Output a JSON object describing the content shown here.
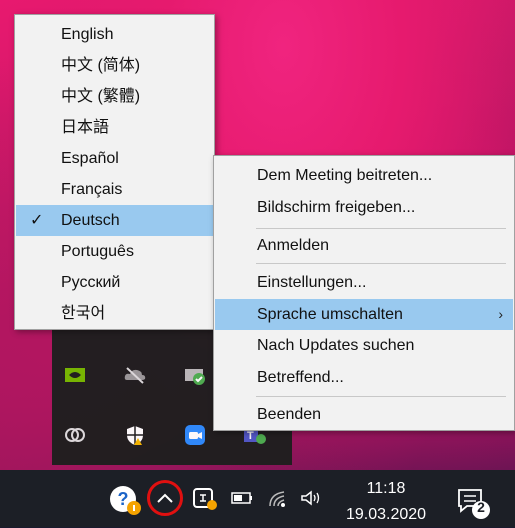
{
  "language_menu": {
    "items": [
      {
        "label": "English",
        "selected": false
      },
      {
        "label": "中文 (简体)",
        "selected": false
      },
      {
        "label": "中文 (繁體)",
        "selected": false
      },
      {
        "label": "日本語",
        "selected": false
      },
      {
        "label": "Español",
        "selected": false
      },
      {
        "label": "Français",
        "selected": false
      },
      {
        "label": "Deutsch",
        "selected": true
      },
      {
        "label": "Português",
        "selected": false
      },
      {
        "label": "Русский",
        "selected": false
      },
      {
        "label": "한국어",
        "selected": false
      }
    ],
    "check_mark": "✓"
  },
  "context_menu": {
    "items": [
      {
        "label": "Dem Meeting beitreten..."
      },
      {
        "label": "Bildschirm freigeben..."
      },
      {
        "label": "Anmelden"
      },
      {
        "label": "Einstellungen..."
      },
      {
        "label": "Sprache umschalten",
        "highlighted": true,
        "submenu": true
      },
      {
        "label": "Nach Updates suchen"
      },
      {
        "label": "Betreffend..."
      },
      {
        "label": "Beenden"
      }
    ],
    "submenu_arrow": "›"
  },
  "taskbar": {
    "clock_time": "11:18",
    "clock_date": "19.03.2020",
    "notification_count": "2",
    "icons": [
      "help-icon",
      "chevron-up-icon",
      "meeting-tray-icon",
      "battery-icon",
      "wifi-icon",
      "volume-icon",
      "notification-icon"
    ]
  },
  "tray_overflow": {
    "icons": [
      "nvidia-icon",
      "onedrive-icon",
      "sync-icon",
      "creative-cloud-icon",
      "security-icon",
      "zoom-icon",
      "teams-icon"
    ]
  }
}
